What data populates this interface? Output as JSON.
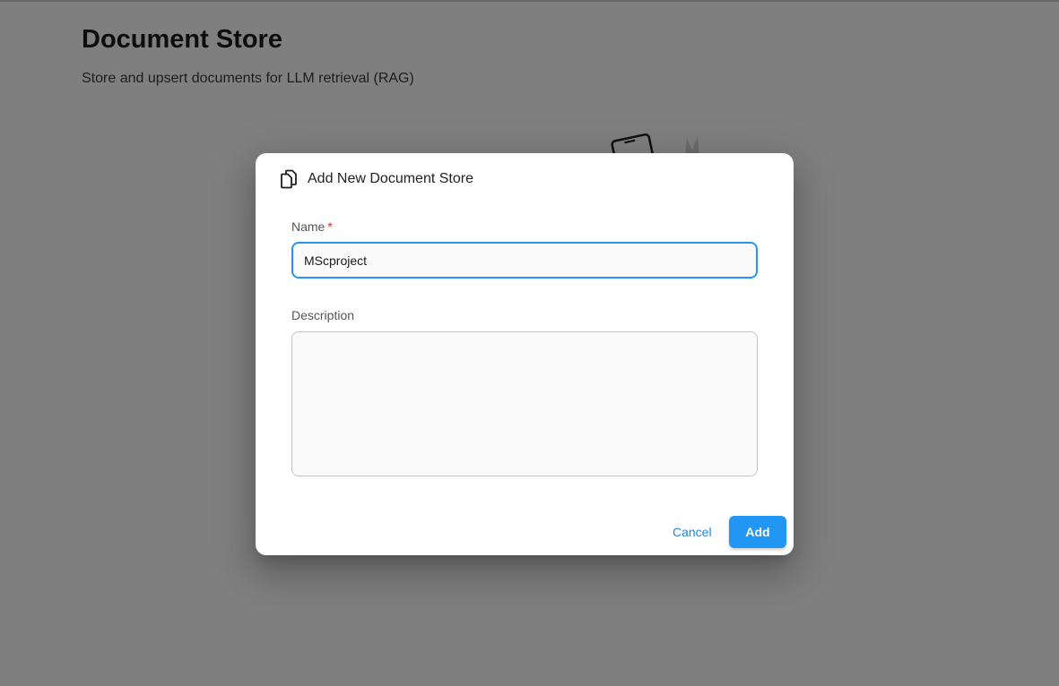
{
  "page": {
    "title": "Document Store",
    "subtitle": "Store and upsert documents for LLM retrieval (RAG)"
  },
  "dialog": {
    "title": "Add New Document Store",
    "icon": "files-icon",
    "name_label": "Name",
    "required_marker": "*",
    "name_value": "MScproject",
    "description_label": "Description",
    "description_value": "",
    "cancel_label": "Cancel",
    "add_label": "Add"
  },
  "colors": {
    "accent": "#2196f3",
    "required": "#d32f2f",
    "overlay": "rgba(0,0,0,0.5)"
  }
}
